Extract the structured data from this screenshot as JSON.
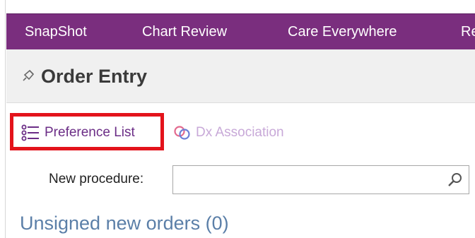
{
  "nav": {
    "tabs": [
      {
        "label": "SnapShot"
      },
      {
        "label": "Chart Review"
      },
      {
        "label": "Care Everywhere"
      },
      {
        "label": "Re"
      }
    ]
  },
  "header": {
    "title": "Order Entry",
    "pin_icon": "pin-icon"
  },
  "toolbar": {
    "preference_list": {
      "label": "Preference List",
      "icon": "list-icon"
    },
    "dx_association": {
      "label": "Dx Association",
      "icon": "link-icon"
    }
  },
  "new_procedure": {
    "label": "New procedure:",
    "value": "",
    "placeholder": "",
    "icon": "search-icon"
  },
  "unsigned_orders": {
    "title": "Unsigned new orders (0)"
  },
  "colors": {
    "nav_bg": "#7a2e7e",
    "accent": "#6b2d86",
    "highlight": "#e3131b",
    "section_title": "#5b7fa8"
  }
}
